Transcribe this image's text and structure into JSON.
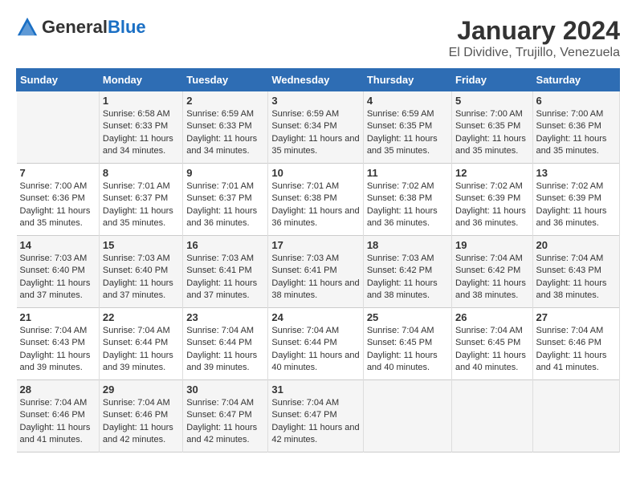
{
  "logo": {
    "general": "General",
    "blue": "Blue"
  },
  "title": "January 2024",
  "subtitle": "El Dividive, Trujillo, Venezuela",
  "days_of_week": [
    "Sunday",
    "Monday",
    "Tuesday",
    "Wednesday",
    "Thursday",
    "Friday",
    "Saturday"
  ],
  "weeks": [
    [
      {
        "day": "",
        "sunrise": "",
        "sunset": "",
        "daylight": ""
      },
      {
        "day": "1",
        "sunrise": "Sunrise: 6:58 AM",
        "sunset": "Sunset: 6:33 PM",
        "daylight": "Daylight: 11 hours and 34 minutes."
      },
      {
        "day": "2",
        "sunrise": "Sunrise: 6:59 AM",
        "sunset": "Sunset: 6:33 PM",
        "daylight": "Daylight: 11 hours and 34 minutes."
      },
      {
        "day": "3",
        "sunrise": "Sunrise: 6:59 AM",
        "sunset": "Sunset: 6:34 PM",
        "daylight": "Daylight: 11 hours and 35 minutes."
      },
      {
        "day": "4",
        "sunrise": "Sunrise: 6:59 AM",
        "sunset": "Sunset: 6:35 PM",
        "daylight": "Daylight: 11 hours and 35 minutes."
      },
      {
        "day": "5",
        "sunrise": "Sunrise: 7:00 AM",
        "sunset": "Sunset: 6:35 PM",
        "daylight": "Daylight: 11 hours and 35 minutes."
      },
      {
        "day": "6",
        "sunrise": "Sunrise: 7:00 AM",
        "sunset": "Sunset: 6:36 PM",
        "daylight": "Daylight: 11 hours and 35 minutes."
      }
    ],
    [
      {
        "day": "7",
        "sunrise": "Sunrise: 7:00 AM",
        "sunset": "Sunset: 6:36 PM",
        "daylight": "Daylight: 11 hours and 35 minutes."
      },
      {
        "day": "8",
        "sunrise": "Sunrise: 7:01 AM",
        "sunset": "Sunset: 6:37 PM",
        "daylight": "Daylight: 11 hours and 35 minutes."
      },
      {
        "day": "9",
        "sunrise": "Sunrise: 7:01 AM",
        "sunset": "Sunset: 6:37 PM",
        "daylight": "Daylight: 11 hours and 36 minutes."
      },
      {
        "day": "10",
        "sunrise": "Sunrise: 7:01 AM",
        "sunset": "Sunset: 6:38 PM",
        "daylight": "Daylight: 11 hours and 36 minutes."
      },
      {
        "day": "11",
        "sunrise": "Sunrise: 7:02 AM",
        "sunset": "Sunset: 6:38 PM",
        "daylight": "Daylight: 11 hours and 36 minutes."
      },
      {
        "day": "12",
        "sunrise": "Sunrise: 7:02 AM",
        "sunset": "Sunset: 6:39 PM",
        "daylight": "Daylight: 11 hours and 36 minutes."
      },
      {
        "day": "13",
        "sunrise": "Sunrise: 7:02 AM",
        "sunset": "Sunset: 6:39 PM",
        "daylight": "Daylight: 11 hours and 36 minutes."
      }
    ],
    [
      {
        "day": "14",
        "sunrise": "Sunrise: 7:03 AM",
        "sunset": "Sunset: 6:40 PM",
        "daylight": "Daylight: 11 hours and 37 minutes."
      },
      {
        "day": "15",
        "sunrise": "Sunrise: 7:03 AM",
        "sunset": "Sunset: 6:40 PM",
        "daylight": "Daylight: 11 hours and 37 minutes."
      },
      {
        "day": "16",
        "sunrise": "Sunrise: 7:03 AM",
        "sunset": "Sunset: 6:41 PM",
        "daylight": "Daylight: 11 hours and 37 minutes."
      },
      {
        "day": "17",
        "sunrise": "Sunrise: 7:03 AM",
        "sunset": "Sunset: 6:41 PM",
        "daylight": "Daylight: 11 hours and 38 minutes."
      },
      {
        "day": "18",
        "sunrise": "Sunrise: 7:03 AM",
        "sunset": "Sunset: 6:42 PM",
        "daylight": "Daylight: 11 hours and 38 minutes."
      },
      {
        "day": "19",
        "sunrise": "Sunrise: 7:04 AM",
        "sunset": "Sunset: 6:42 PM",
        "daylight": "Daylight: 11 hours and 38 minutes."
      },
      {
        "day": "20",
        "sunrise": "Sunrise: 7:04 AM",
        "sunset": "Sunset: 6:43 PM",
        "daylight": "Daylight: 11 hours and 38 minutes."
      }
    ],
    [
      {
        "day": "21",
        "sunrise": "Sunrise: 7:04 AM",
        "sunset": "Sunset: 6:43 PM",
        "daylight": "Daylight: 11 hours and 39 minutes."
      },
      {
        "day": "22",
        "sunrise": "Sunrise: 7:04 AM",
        "sunset": "Sunset: 6:44 PM",
        "daylight": "Daylight: 11 hours and 39 minutes."
      },
      {
        "day": "23",
        "sunrise": "Sunrise: 7:04 AM",
        "sunset": "Sunset: 6:44 PM",
        "daylight": "Daylight: 11 hours and 39 minutes."
      },
      {
        "day": "24",
        "sunrise": "Sunrise: 7:04 AM",
        "sunset": "Sunset: 6:44 PM",
        "daylight": "Daylight: 11 hours and 40 minutes."
      },
      {
        "day": "25",
        "sunrise": "Sunrise: 7:04 AM",
        "sunset": "Sunset: 6:45 PM",
        "daylight": "Daylight: 11 hours and 40 minutes."
      },
      {
        "day": "26",
        "sunrise": "Sunrise: 7:04 AM",
        "sunset": "Sunset: 6:45 PM",
        "daylight": "Daylight: 11 hours and 40 minutes."
      },
      {
        "day": "27",
        "sunrise": "Sunrise: 7:04 AM",
        "sunset": "Sunset: 6:46 PM",
        "daylight": "Daylight: 11 hours and 41 minutes."
      }
    ],
    [
      {
        "day": "28",
        "sunrise": "Sunrise: 7:04 AM",
        "sunset": "Sunset: 6:46 PM",
        "daylight": "Daylight: 11 hours and 41 minutes."
      },
      {
        "day": "29",
        "sunrise": "Sunrise: 7:04 AM",
        "sunset": "Sunset: 6:46 PM",
        "daylight": "Daylight: 11 hours and 42 minutes."
      },
      {
        "day": "30",
        "sunrise": "Sunrise: 7:04 AM",
        "sunset": "Sunset: 6:47 PM",
        "daylight": "Daylight: 11 hours and 42 minutes."
      },
      {
        "day": "31",
        "sunrise": "Sunrise: 7:04 AM",
        "sunset": "Sunset: 6:47 PM",
        "daylight": "Daylight: 11 hours and 42 minutes."
      },
      {
        "day": "",
        "sunrise": "",
        "sunset": "",
        "daylight": ""
      },
      {
        "day": "",
        "sunrise": "",
        "sunset": "",
        "daylight": ""
      },
      {
        "day": "",
        "sunrise": "",
        "sunset": "",
        "daylight": ""
      }
    ]
  ]
}
